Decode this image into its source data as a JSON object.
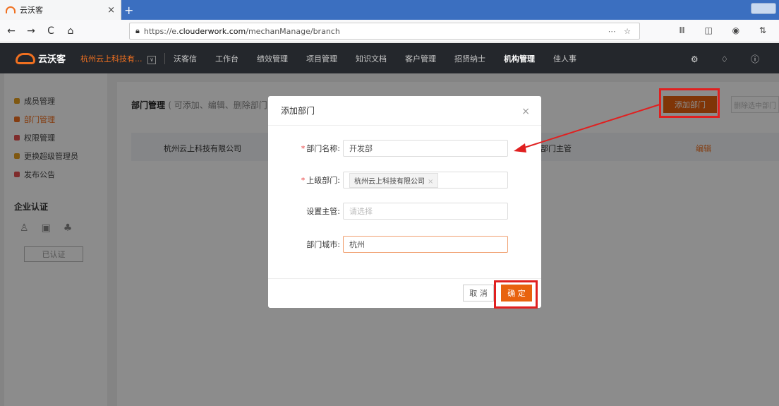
{
  "browser": {
    "tab_title": "云沃客",
    "tab_close": "×",
    "new_tab": "+",
    "url_prefix": "https://e.",
    "url_domain": "clouderwork.com",
    "url_path": "/mechanManage/branch",
    "url_more": "⋯ ☆",
    "nav_back": "←",
    "nav_forward": "→",
    "nav_reload": "C",
    "nav_home": "⌂",
    "toolbar_icons": "Ⅲ ◫ ◉ ⇅"
  },
  "header": {
    "logo_text": "云沃客",
    "company": "杭州云上科技有...",
    "company_drop": "∨",
    "menu": [
      {
        "label": "沃客信"
      },
      {
        "label": "工作台"
      },
      {
        "label": "绩效管理"
      },
      {
        "label": "项目管理"
      },
      {
        "label": "知识文档"
      },
      {
        "label": "客户管理"
      },
      {
        "label": "招贤纳士"
      },
      {
        "label": "机构管理"
      },
      {
        "label": "佳人事"
      }
    ],
    "icons": "⚙ ♢ ⓘ"
  },
  "sidebar": {
    "items": [
      {
        "label": "成员管理",
        "color": "#e8a020"
      },
      {
        "label": "部门管理",
        "color": "#f07020"
      },
      {
        "label": "权限管理",
        "color": "#e85050"
      },
      {
        "label": "更换超级管理员",
        "color": "#e8a020"
      },
      {
        "label": "发布公告",
        "color": "#e85050"
      }
    ],
    "enterprise_title": "企业认证",
    "enterprise_icons": [
      "♙",
      "▣",
      "♣"
    ],
    "certified_label": "已认证"
  },
  "main": {
    "title": "部门管理",
    "subtitle": "( 可添加、编辑、删除部门",
    "add_button": "添加部门",
    "delete_button": "删除选中部门",
    "row": {
      "company": "杭州云上科技有限公司",
      "manager_col": "部门主管",
      "edit": "编辑"
    }
  },
  "dialog": {
    "title": "添加部门",
    "close": "×",
    "fields": {
      "name_label": "部门名称:",
      "name_value": "开发部",
      "parent_label": "上级部门:",
      "parent_chip": "杭州云上科技有限公司",
      "parent_chip_x": "×",
      "manager_label": "设置主管:",
      "manager_placeholder": "请选择",
      "city_label": "部门城市:",
      "city_value": "杭州"
    },
    "required_mark": "*",
    "cancel": "取 消",
    "ok": "确 定"
  },
  "colors": {
    "accent": "#e8620e",
    "annotation": "#e02020",
    "header_bg": "#24272c"
  }
}
